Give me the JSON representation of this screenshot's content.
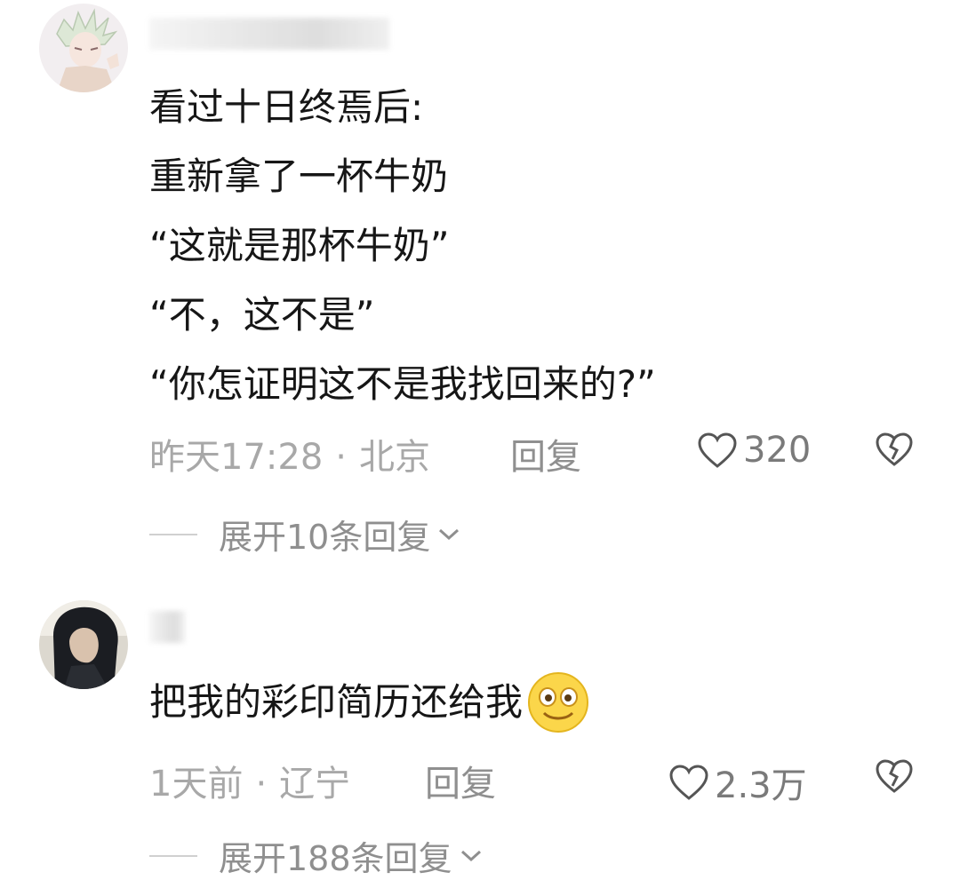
{
  "comments": [
    {
      "lines": [
        "看过十日终焉后:",
        "重新拿了一杯牛奶",
        "“这就是那杯牛奶”",
        "“不，这不是”",
        "“你怎证明这不是我找回来的?”"
      ],
      "time": "昨天17:28",
      "separator": "·",
      "location": "北京",
      "reply_label": "回复",
      "likes": "320",
      "expand_label": "展开10条回复"
    },
    {
      "lines": [
        "把我的彩印简历还给我"
      ],
      "emoji": "smile-emoji",
      "time": "1天前",
      "separator": "·",
      "location": "辽宁",
      "reply_label": "回复",
      "likes": "2.3万",
      "expand_label": "展开188条回复"
    }
  ],
  "icons": {
    "like": "heart-outline-icon",
    "dislike": "broken-heart-icon",
    "expand": "chevron-down-icon"
  }
}
